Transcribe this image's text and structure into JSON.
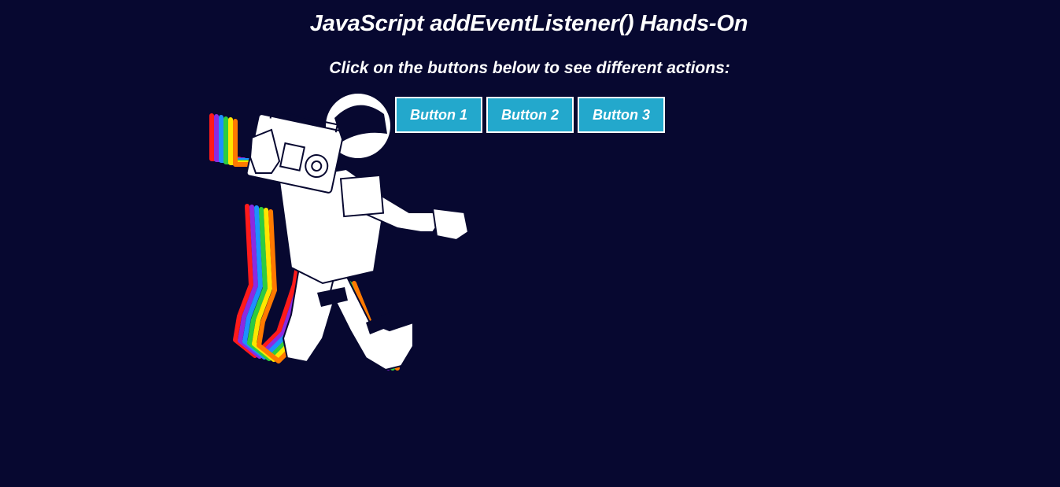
{
  "page": {
    "title": "JavaScript addEventListener() Hands-On",
    "subtitle": "Click on the buttons below to see different actions:"
  },
  "buttons": [
    {
      "label": "Button 1"
    },
    {
      "label": "Button 2"
    },
    {
      "label": "Button 3"
    }
  ],
  "illustration": {
    "icon": "astronaut-with-boombox-icon"
  },
  "colors": {
    "background": "#070830",
    "button": "#23a8cc",
    "text": "#ffffff"
  }
}
